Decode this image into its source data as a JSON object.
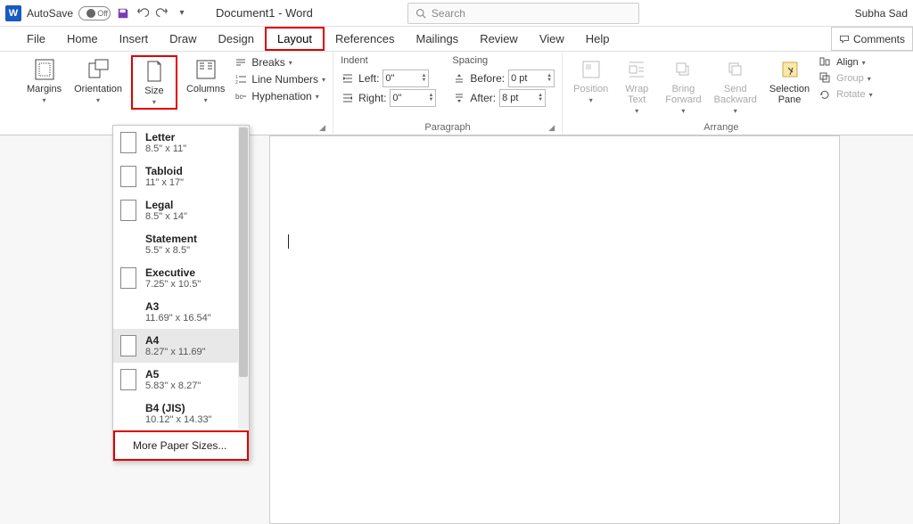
{
  "titlebar": {
    "autosave_label": "AutoSave",
    "autosave_state": "Off",
    "doc_title": "Document1 - Word",
    "search_placeholder": "Search",
    "user_name": "Subha Sad"
  },
  "tabs": {
    "file": "File",
    "home": "Home",
    "insert": "Insert",
    "draw": "Draw",
    "design": "Design",
    "layout": "Layout",
    "references": "References",
    "mailings": "Mailings",
    "review": "Review",
    "view": "View",
    "help": "Help",
    "comments": "Comments"
  },
  "ribbon": {
    "page_setup": {
      "margins": "Margins",
      "orientation": "Orientation",
      "size": "Size",
      "columns": "Columns",
      "breaks": "Breaks",
      "line_numbers": "Line Numbers",
      "hyphenation": "Hyphenation"
    },
    "paragraph": {
      "group_label": "Paragraph",
      "indent_label": "Indent",
      "spacing_label": "Spacing",
      "left_label": "Left:",
      "right_label": "Right:",
      "before_label": "Before:",
      "after_label": "After:",
      "left_val": "0\"",
      "right_val": "0\"",
      "before_val": "0 pt",
      "after_val": "8 pt"
    },
    "arrange": {
      "group_label": "Arrange",
      "position": "Position",
      "wrap_text": "Wrap\nText",
      "bring_forward": "Bring\nForward",
      "send_backward": "Send\nBackward",
      "selection_pane": "Selection\nPane",
      "align": "Align",
      "group": "Group",
      "rotate": "Rotate"
    }
  },
  "size_menu": {
    "items": [
      {
        "name": "Letter",
        "dims": "8.5\" x 11\"",
        "icon": true,
        "hover": false
      },
      {
        "name": "Tabloid",
        "dims": "11\" x 17\"",
        "icon": true,
        "hover": false
      },
      {
        "name": "Legal",
        "dims": "8.5\" x 14\"",
        "icon": true,
        "hover": false
      },
      {
        "name": "Statement",
        "dims": "5.5\" x 8.5\"",
        "icon": false,
        "hover": false
      },
      {
        "name": "Executive",
        "dims": "7.25\" x 10.5\"",
        "icon": true,
        "hover": false
      },
      {
        "name": "A3",
        "dims": "11.69\" x 16.54\"",
        "icon": false,
        "hover": false
      },
      {
        "name": "A4",
        "dims": "8.27\" x 11.69\"",
        "icon": true,
        "hover": true
      },
      {
        "name": "A5",
        "dims": "5.83\" x 8.27\"",
        "icon": true,
        "hover": false
      },
      {
        "name": "B4 (JIS)",
        "dims": "10.12\" x 14.33\"",
        "icon": false,
        "hover": false
      }
    ],
    "more": "More Paper Sizes..."
  }
}
